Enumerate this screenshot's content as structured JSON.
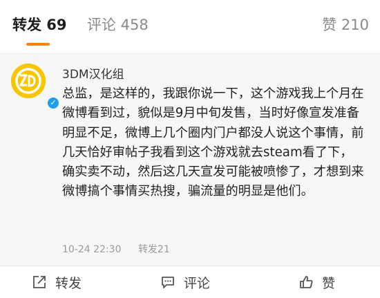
{
  "tabs": {
    "repost": "转发 69",
    "comment": "评论 458",
    "like": "赞 210"
  },
  "post": {
    "username": "3DM汉化组",
    "content": "总监，是这样的，我跟你说一下，这个游戏我上个月在微博看到过，貌似是9月中旬发售，当时好像宣发准备明显不足，微博上几个圈内门户都没人说这个事情，前几天恰好审帖子我看到这个游戏就去steam看了下，确实卖不动，然后这几天宣发可能被喷惨了，才想到来微博搞个事情买热搜，骗流量的明显是他们。",
    "timestamp": "10-24 22:30",
    "reposts": "转发21"
  },
  "actions": {
    "repost": "转发",
    "comment": "评论",
    "like": "赞"
  },
  "colors": {
    "accent": "#ff8200",
    "verified": "#1f9ef0",
    "avatar": "#f7c600"
  },
  "icons": {
    "repost": "share-arrow-icon",
    "comment": "comment-bubble-icon",
    "like": "thumbs-up-icon"
  }
}
